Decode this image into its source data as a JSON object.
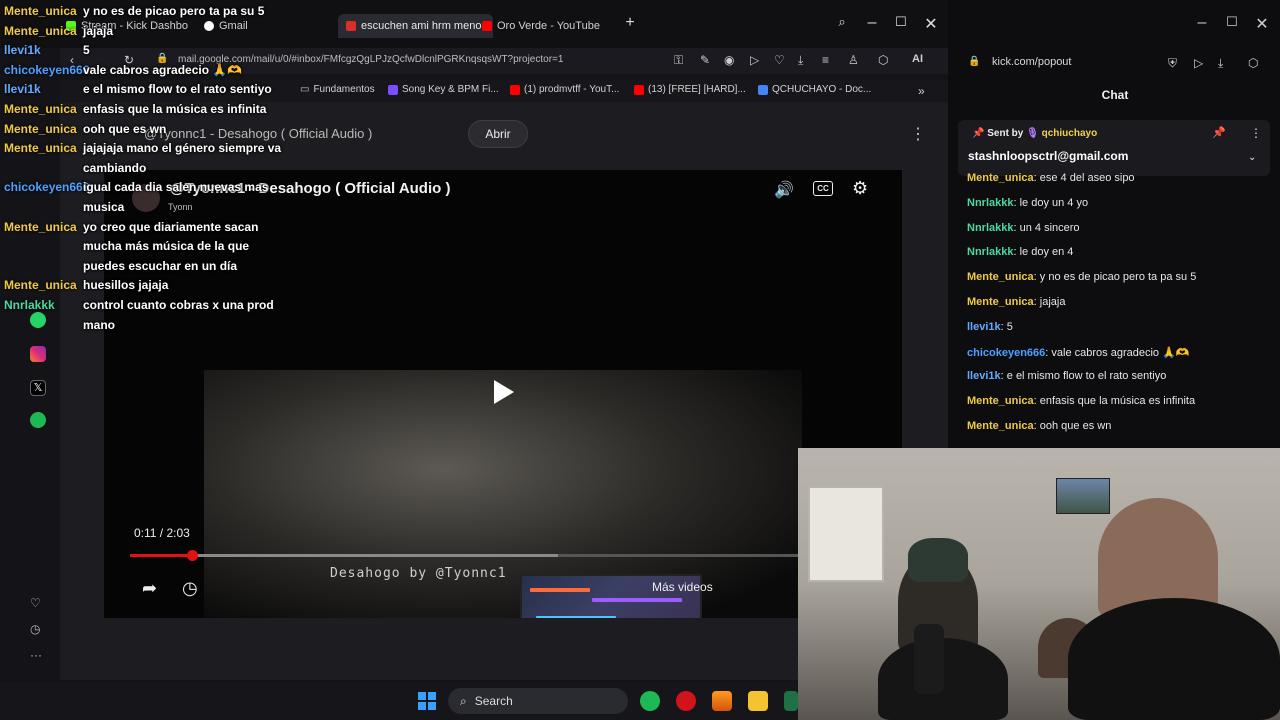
{
  "left_browser": {
    "tabs": [
      {
        "label": "Stream - Kick Dashbo",
        "color": "#53fc18"
      },
      {
        "label": "Gmail",
        "color": "#ffffff"
      },
      {
        "label": "escuchen ami hrm menor",
        "color": "#d93025",
        "active": true
      },
      {
        "label": "Oro Verde - YouTube",
        "color": "#ff0000"
      }
    ],
    "url": "mail.google.com/mail/u/0/#inbox/FMfcgzQgLPJzQcfwDlcnlPGRKnqsqsWT?projector=1",
    "bookmarks": [
      {
        "label": "Fundamentos",
        "icon": "folder-icon"
      },
      {
        "label": "Song Key & BPM Fi...",
        "icon": "music-icon"
      },
      {
        "label": "(1) prodmvtff - YouT...",
        "icon": "youtube-icon"
      },
      {
        "label": "(13) [FREE] [HARD]...",
        "icon": "youtube-icon"
      },
      {
        "label": "QCHUCHAYO - Doc...",
        "icon": "docs-icon"
      }
    ],
    "bookmark_more": "»",
    "toolbar_ai": "AI"
  },
  "youtube": {
    "top_title": "@Tyonnc1 - Desahogo ( Official Audio )",
    "open_button": "Abrir",
    "video_title": "@Tyonnc1 - Desahogo ( Official Audio )",
    "channel": "Tyonn",
    "cc": "CC",
    "current_time": "0:11 / 2:03",
    "progress": 0.09,
    "buffered": 0.62,
    "caption": "Desahogo by @Tyonnc1",
    "more_videos": "Más videos"
  },
  "overlay_chat": [
    {
      "user": "Mente_unica",
      "msg": "y no es de picao pero ta pa su 5",
      "color": "#f0c94a"
    },
    {
      "user": "Mente_unica",
      "msg": "jajaja",
      "color": "#f0c94a"
    },
    {
      "user": "llevi1k",
      "msg": "5",
      "color": "#66aaff"
    },
    {
      "user": "chicokeyen666",
      "msg": "vale cabros agradecio 🙏🫶",
      "color": "#4fa0ff"
    },
    {
      "user": "llevi1k",
      "msg": "e el mismo flow to el rato sentiyo",
      "color": "#66aaff"
    },
    {
      "user": "Mente_unica",
      "msg": "enfasis que la música es infinita",
      "color": "#f0c94a"
    },
    {
      "user": "Mente_unica",
      "msg": "ooh que es wn",
      "color": "#f0c94a"
    },
    {
      "user": "Mente_unica",
      "msg": "jajajaja mano el género siempre va",
      "color": "#f0c94a"
    },
    {
      "user": "",
      "msg": "cambiando",
      "color": "#f0c94a"
    },
    {
      "user": "chicokeyen666",
      "msg": "igual cada dia salen nuevas mas",
      "color": "#4fa0ff"
    },
    {
      "user": "",
      "msg": "musica",
      "color": "#4fa0ff"
    },
    {
      "user": "Mente_unica",
      "msg": "yo creo que diariamente sacan",
      "color": "#f0c94a"
    },
    {
      "user": "",
      "msg": "mucha más música de la que",
      "color": "#f0c94a"
    },
    {
      "user": "",
      "msg": "puedes escuchar en un día",
      "color": "#f0c94a"
    },
    {
      "user": "Mente_unica",
      "msg": "huesillos jajaja",
      "color": "#f0c94a"
    },
    {
      "user": "Nnrlakkk",
      "msg": "control cuanto cobras x una prod",
      "color": "#4fd8a0"
    },
    {
      "user": "",
      "msg": "mano",
      "color": "#4fd8a0"
    }
  ],
  "taskbar": {
    "search": "Search"
  },
  "kick": {
    "url": "kick.com/popout",
    "title": "Chat",
    "pinned": {
      "sent_by": "Sent by",
      "user": "qchiuchayo",
      "msg": "stashnloopsctrl@gmail.com"
    },
    "messages": [
      {
        "user": "Mente_unica",
        "msg": "ese 4 del aseo sipo",
        "color": "#f0c94a"
      },
      {
        "user": "Nnrlakkk",
        "msg": "le doy un 4 yo",
        "color": "#4fd8a0"
      },
      {
        "user": "Nnrlakkk",
        "msg": "un 4 sincero",
        "color": "#4fd8a0"
      },
      {
        "user": "Nnrlakkk",
        "msg": "le doy en 4",
        "color": "#4fd8a0"
      },
      {
        "user": "Mente_unica",
        "msg": "y no es de picao pero ta pa su 5",
        "color": "#f0c94a"
      },
      {
        "user": "Mente_unica",
        "msg": "jajaja",
        "color": "#f0c94a"
      },
      {
        "user": "llevi1k",
        "msg": "5",
        "color": "#66aaff"
      },
      {
        "user": "chicokeyen666",
        "msg": "vale cabros agradecio 🙏🫶",
        "color": "#4fa0ff"
      },
      {
        "user": "llevi1k",
        "msg": "e el mismo flow to el rato sentiyo",
        "color": "#66aaff"
      },
      {
        "user": "Mente_unica",
        "msg": "enfasis que la música es infinita",
        "color": "#f0c94a"
      },
      {
        "user": "Mente_unica",
        "msg": "ooh que es wn",
        "color": "#f0c94a"
      }
    ]
  }
}
